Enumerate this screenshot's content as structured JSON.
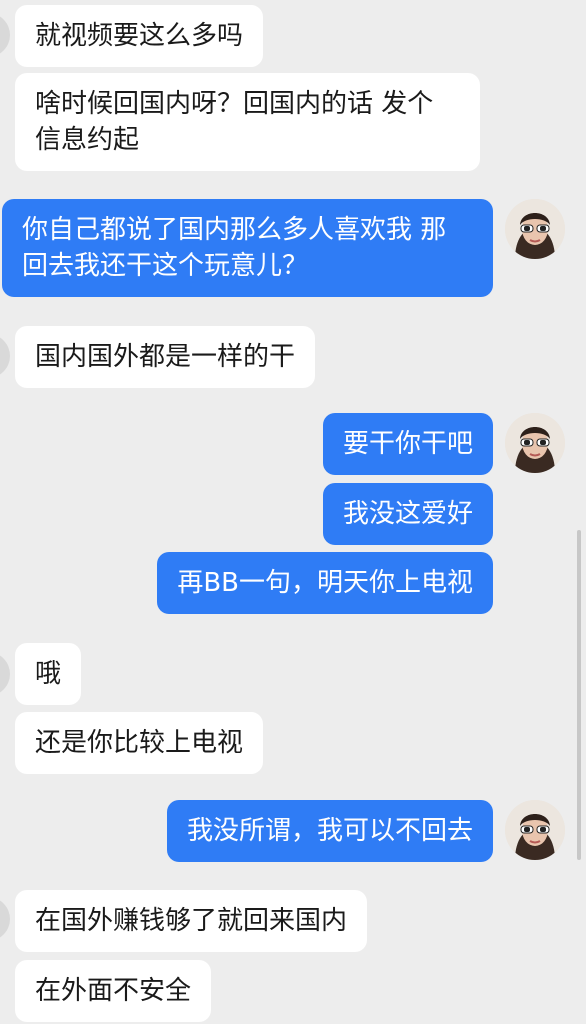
{
  "messages": [
    {
      "side": "in",
      "text": "就视频要这么多吗"
    },
    {
      "side": "in",
      "text": "啥时候回国内呀？回国内的话 发个\n信息约起"
    },
    {
      "side": "out",
      "text": "你自己都说了国内那么多人喜欢我 那\n回去我还干这个玩意儿？"
    },
    {
      "side": "in",
      "text": "国内国外都是一样的干"
    },
    {
      "side": "out",
      "text": "要干你干吧"
    },
    {
      "side": "out",
      "text": "我没这爱好"
    },
    {
      "side": "out",
      "text": "再BB一句，明天你上电视"
    },
    {
      "side": "in",
      "text": "哦"
    },
    {
      "side": "in",
      "text": "还是你比较上电视"
    },
    {
      "side": "out",
      "text": "我没所谓，我可以不回去"
    },
    {
      "side": "in",
      "text": "在国外赚钱够了就回来国内"
    },
    {
      "side": "in",
      "text": "在外面不安全"
    }
  ],
  "colors": {
    "background": "#ededed",
    "incoming_bubble": "#ffffff",
    "outgoing_bubble": "#2f7cf5"
  },
  "icons": {
    "self_avatar": "avatar-woman-sunglasses-icon",
    "contact_avatar": "contact-avatar-icon"
  }
}
